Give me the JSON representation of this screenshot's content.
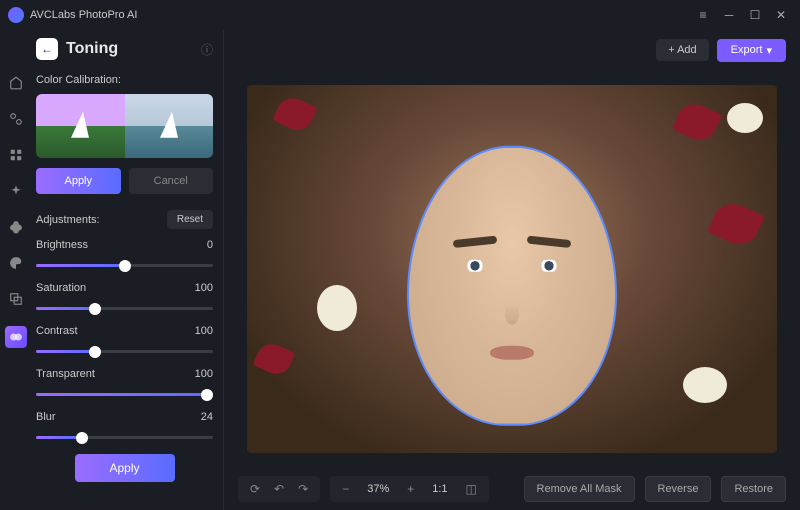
{
  "app_name": "AVCLabs PhotoPro AI",
  "panel": {
    "title": "Toning",
    "calibration_label": "Color Calibration:",
    "apply_label": "Apply",
    "cancel_label": "Cancel",
    "adjustments_label": "Adjustments:",
    "reset_label": "Reset",
    "apply_big_label": "Apply"
  },
  "sliders": {
    "brightness": {
      "label": "Brightness",
      "value": "0",
      "num": 50
    },
    "saturation": {
      "label": "Saturation",
      "value": "100",
      "num": 32
    },
    "contrast": {
      "label": "Contrast",
      "value": "100",
      "num": 32
    },
    "transparent": {
      "label": "Transparent",
      "value": "100",
      "num": 100
    },
    "blur": {
      "label": "Blur",
      "value": "24",
      "num": 24
    }
  },
  "top": {
    "add": "+ Add",
    "export": "Export"
  },
  "bottom": {
    "zoom": "37%",
    "ratio": "1:1",
    "remove_mask": "Remove All Mask",
    "reverse": "Reverse",
    "restore": "Restore"
  },
  "colors": {
    "accent": "#7a5cff",
    "mask_outline": "#5a8cff"
  }
}
